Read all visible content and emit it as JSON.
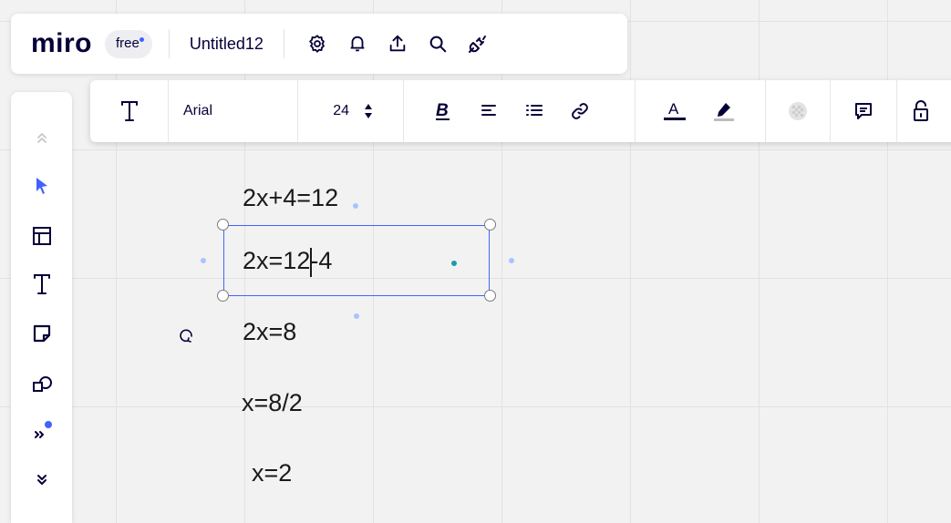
{
  "app": {
    "logo": "miro",
    "plan_badge": "free",
    "board_title": "Untitled12"
  },
  "topbar_icons": [
    "settings-icon",
    "bell-icon",
    "upload-icon",
    "search-icon",
    "plug-icon"
  ],
  "left_toolbar": [
    "collapse-up-icon",
    "select-cursor-icon",
    "templates-icon",
    "text-tool-icon",
    "sticky-note-icon",
    "shapes-icon",
    "more-tools-icon",
    "expand-down-icon"
  ],
  "context_toolbar": {
    "font_name": "Arial",
    "font_size": "24"
  },
  "canvas": {
    "lines": [
      "2x+4=12",
      "2x=1",
      "2-4",
      "2x=8",
      "x=8/2",
      "x=2"
    ]
  },
  "colors": {
    "accent": "#4262ff",
    "notification_dot": "#4262ff",
    "center_dot": "#1a9bb0"
  }
}
